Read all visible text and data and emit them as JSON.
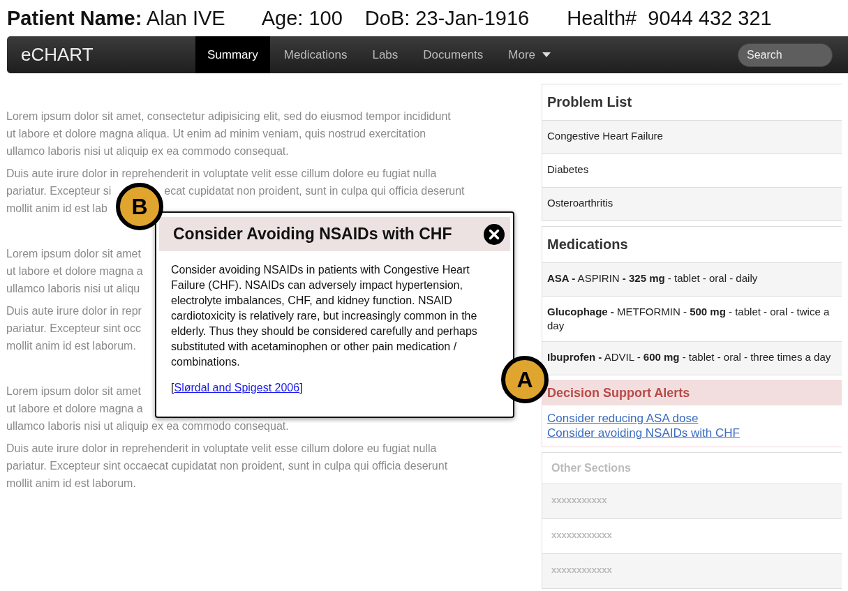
{
  "patient": [
    "**Patient Name:** Alan IVE",
    "Age: 100",
    "DoB: 23-Jan-1916",
    "Health#  9044 432 321"
  ],
  "navbar": {
    "brand": "eCHART",
    "tabs": [
      {
        "label": "Summary",
        "selected": true,
        "dropdown": false
      },
      {
        "label": "Medications",
        "selected": false,
        "dropdown": false
      },
      {
        "label": "Labs",
        "selected": false,
        "dropdown": false
      },
      {
        "label": "Documents",
        "selected": false,
        "dropdown": false
      },
      {
        "label": "More",
        "selected": false,
        "dropdown": true
      }
    ],
    "search": {
      "placeholder": "Search"
    }
  },
  "content": [
    {
      "paragraphs": [
        {
          "lines": [
            [
              "Lorem ipsum dolor sit amet, consectetur adipisicing elit, sed do eiusmod tempor incididunt"
            ],
            [
              "ut labore et dolore magna aliqua. Ut enim ad minim veniam, quis nostrud exercitation"
            ],
            [
              "ullamco laboris nisi ut aliquip ex ea commodo consequat."
            ]
          ]
        },
        {
          "lines": [
            [
              "Duis aute irure dolor in reprehenderit in voluptate velit esse cillum dolore eu fugiat nulla"
            ],
            [
              "pariatur. Excepteur si",
              "ecat cupidatat non proident, sunt in culpa qui officia deserunt"
            ],
            [
              "mollit anim id est lab"
            ]
          ]
        }
      ]
    },
    {
      "paragraphs": [
        {
          "lines": [
            [
              "Lorem ipsum dolor sit amet"
            ],
            [
              "ut labore et dolore magna a"
            ],
            [
              "ullamco laboris nisi ut aliqu"
            ]
          ]
        },
        {
          "lines": [
            [
              "Duis aute irure dolor in repr"
            ],
            [
              "pariatur. Excepteur sint occ"
            ],
            [
              "mollit anim id est laborum."
            ]
          ]
        }
      ]
    },
    {
      "paragraphs": [
        {
          "lines": [
            [
              "Lorem ipsum dolor sit amet"
            ],
            [
              "ut labore et dolore magna a"
            ],
            [
              "ullamco laboris nisi ut aliquip ex ea commodo consequat."
            ]
          ]
        },
        {
          "lines": [
            [
              "Duis aute irure dolor in reprehenderit in voluptate velit esse cillum dolore eu fugiat nulla"
            ],
            [
              "pariatur. Excepteur sint occaecat cupidatat non proident, sunt in culpa qui officia deserunt"
            ],
            [
              "mollit anim id est laborum."
            ]
          ]
        }
      ]
    }
  ],
  "alert_dialog": {
    "title": "Consider Avoiding NSAIDs with CHF",
    "body": "Consider avoiding NSAIDs in patients with Congestive Heart Failure (CHF). NSAIDs can adversely impact hypertension, electrolyte imbalances, CHF, and kidney function. NSAID cardiotoxicity is relatively rare, but increasingly common in the elderly. Thus they should be considered carefully and perhaps substituted with acetaminophen or other pain medication / combinations.",
    "reference": {
      "before": "[",
      "link": "Slørdal and Spigest 2006",
      "after": "]"
    }
  },
  "callouts": [
    {
      "label": "B"
    },
    {
      "label": "A"
    }
  ],
  "sidebar": {
    "sections": [
      {
        "kind": "list",
        "title": "Problem List",
        "items": [
          "Congestive Heart Failure",
          "Diabetes",
          "Osteroarthritis"
        ]
      },
      {
        "kind": "list",
        "title": "Medications",
        "items": [
          "**ASA -** ASPIRIN **- 325 mg** - tablet - oral - daily",
          "**Glucophage -** METFORMIN - **500 mg** - tablet - oral - twice a day",
          "**Ibuprofen -** ADVIL - **600 mg** - tablet - oral - three times a day"
        ]
      },
      {
        "kind": "alerts",
        "title": "Decision Support Alerts",
        "items": [
          "Consider reducing ASA dose",
          "Consider avoiding NSAIDs with CHF"
        ]
      },
      {
        "kind": "muted",
        "title": "Other Sections",
        "items": [
          "xxxxxxxxxxx",
          "xxxxxxxxxxxx",
          "xxxxxxxxxxxx"
        ]
      }
    ]
  }
}
